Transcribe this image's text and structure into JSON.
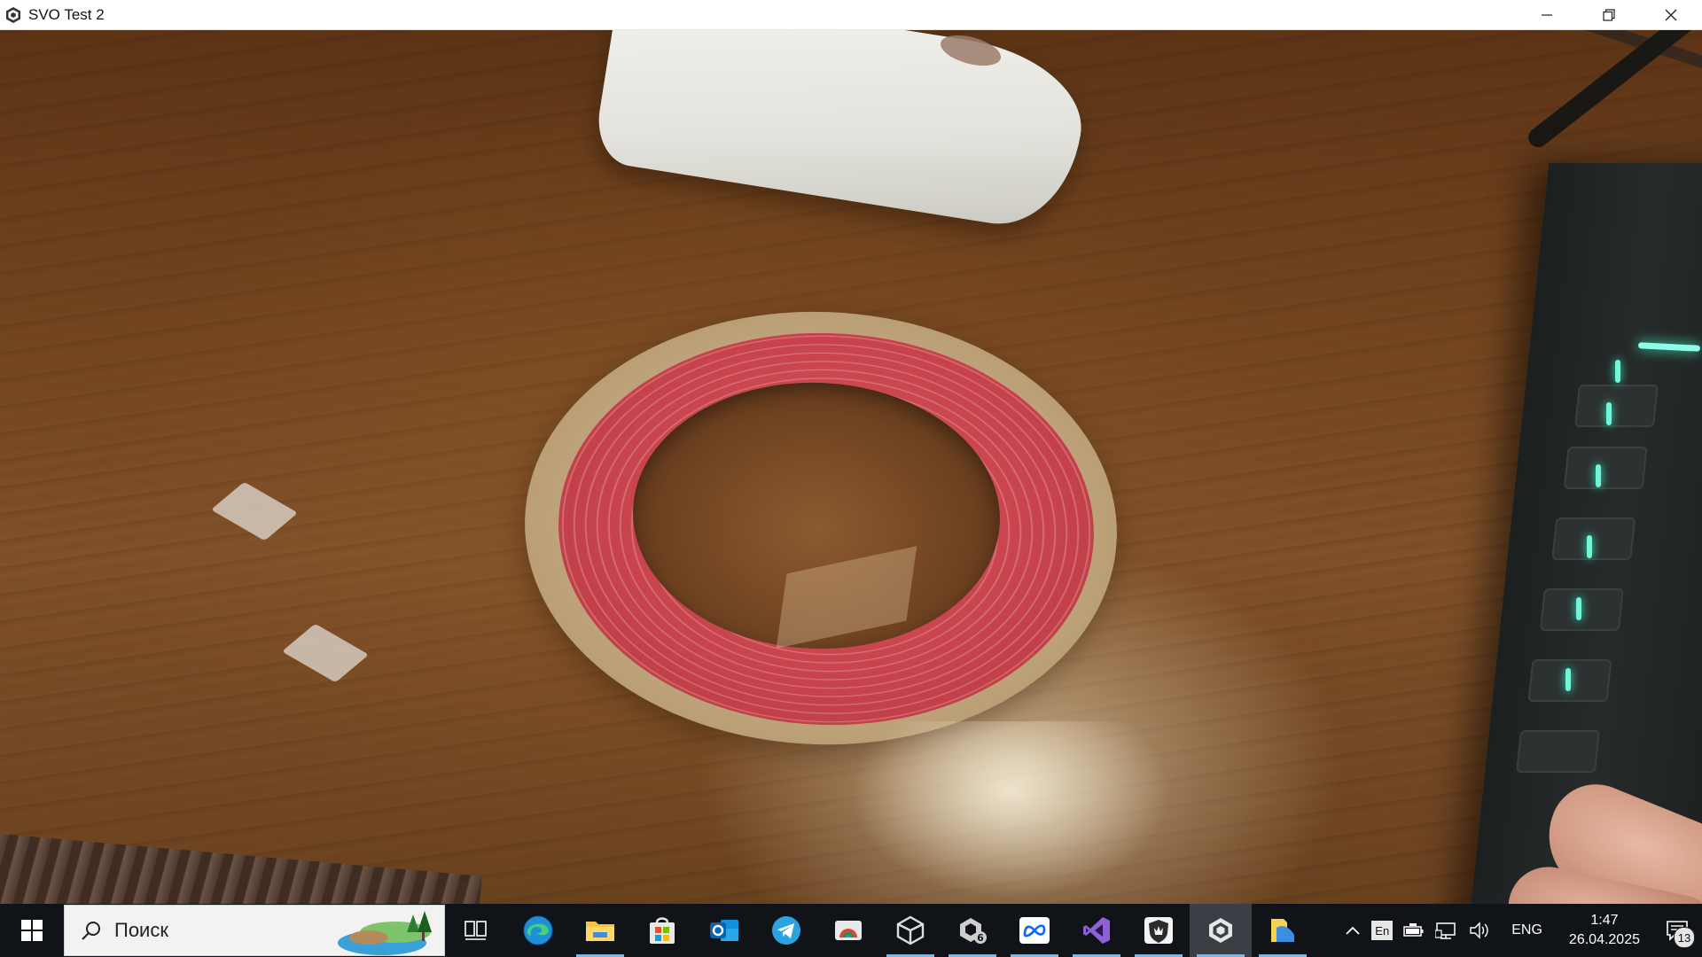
{
  "window": {
    "title": "SVO Test 2",
    "app_icon": "unity-icon",
    "controls": [
      "minimize-icon",
      "restore-icon",
      "close-icon"
    ]
  },
  "taskbar": {
    "search": {
      "placeholder": "Поиск"
    },
    "pinned_apps": [
      {
        "name": "task-view",
        "icon": "task-view-icon",
        "active": false
      },
      {
        "name": "edge",
        "icon": "edge-icon",
        "active": false
      },
      {
        "name": "file-explorer",
        "icon": "folder-icon",
        "active": true
      },
      {
        "name": "microsoft-store",
        "icon": "store-icon",
        "active": false
      },
      {
        "name": "outlook",
        "icon": "outlook-icon",
        "active": false
      },
      {
        "name": "telegram",
        "icon": "telegram-icon",
        "active": false
      },
      {
        "name": "chrome-remote",
        "icon": "remote-icon",
        "active": false
      },
      {
        "name": "unity-hub",
        "icon": "unity-icon",
        "active": true
      },
      {
        "name": "unity-6",
        "icon": "unity-6-icon",
        "active": true
      },
      {
        "name": "meta",
        "icon": "meta-icon",
        "active": true
      },
      {
        "name": "visual-studio",
        "icon": "visual-studio-icon",
        "active": true
      },
      {
        "name": "shield-app",
        "icon": "shield-icon",
        "active": true
      },
      {
        "name": "unity-player",
        "icon": "unity-icon",
        "active": true,
        "focused": true
      },
      {
        "name": "files",
        "icon": "files-icon",
        "active": true
      }
    ],
    "tray": {
      "keyboard_layout": "En",
      "language": "ENG",
      "time": "1:47",
      "date": "26.04.2025",
      "notification_count": "13"
    }
  }
}
